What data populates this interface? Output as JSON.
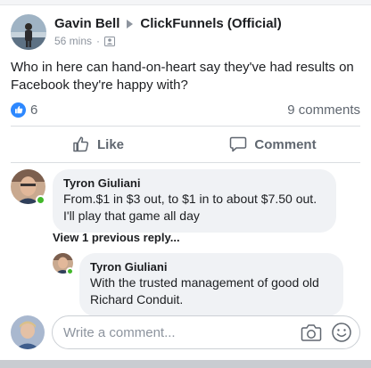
{
  "post": {
    "author": "Gavin Bell",
    "group": "ClickFunnels (Official)",
    "time": "56 mins",
    "text": "Who in here can hand-on-heart say they've had results on Facebook they're happy with?",
    "likes_count": "6",
    "comments_count": "9 comments"
  },
  "actions": {
    "like_label": "Like",
    "comment_label": "Comment"
  },
  "comments": [
    {
      "author": "Tyron Giuliani",
      "lines": [
        "From.$1 in $3 out, to $1 in to about $7.50 out.",
        "I'll play that game all day"
      ]
    }
  ],
  "view_previous": "View 1 previous reply...",
  "reply": {
    "author": "Tyron Giuliani",
    "lines": [
      "With the trusted management of good old",
      "Richard Conduit."
    ]
  },
  "composer": {
    "placeholder": "Write a comment..."
  },
  "colors": {
    "like_blue": "#2d88ff",
    "online_green": "#42b72a",
    "bubble_gray": "#f0f2f5"
  },
  "icons": [
    "group-icon",
    "like-thumb-icon",
    "comment-icon",
    "camera-icon",
    "emoji-icon"
  ]
}
